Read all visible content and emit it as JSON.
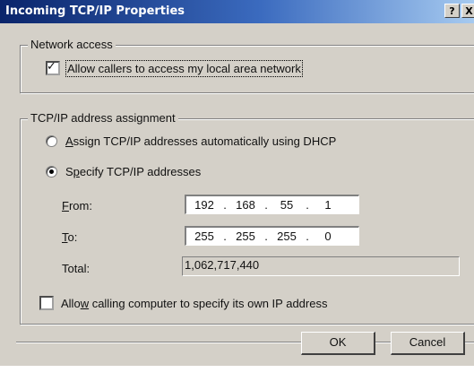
{
  "window": {
    "title": "Incoming TCP/IP Properties",
    "help_icon": "?",
    "close_icon": "X"
  },
  "network_access": {
    "legend": "Network access",
    "allow_lan": {
      "label": "Allow callers to access my local area network",
      "checked": true
    }
  },
  "ip_assignment": {
    "legend": "TCP/IP address assignment",
    "option_dhcp": {
      "label_accel": "A",
      "label_rest": "ssign TCP/IP addresses automatically using DHCP",
      "selected": false
    },
    "option_specify": {
      "label_pre": "S",
      "label_accel": "p",
      "label_rest": "ecify TCP/IP addresses",
      "selected": true
    },
    "from": {
      "label_accel": "F",
      "label_rest": "rom:",
      "octets": [
        "192",
        "168",
        "55",
        "1"
      ]
    },
    "to": {
      "label_accel": "T",
      "label_rest": "o:",
      "octets": [
        "255",
        "255",
        "255",
        "0"
      ]
    },
    "total": {
      "label": "Total:",
      "value": "1,062,717,440"
    },
    "allow_own_ip": {
      "label_pre": "Allo",
      "label_accel": "w",
      "label_rest": " calling computer to specify its own IP address",
      "checked": false
    }
  },
  "buttons": {
    "ok": "OK",
    "cancel": "Cancel"
  }
}
